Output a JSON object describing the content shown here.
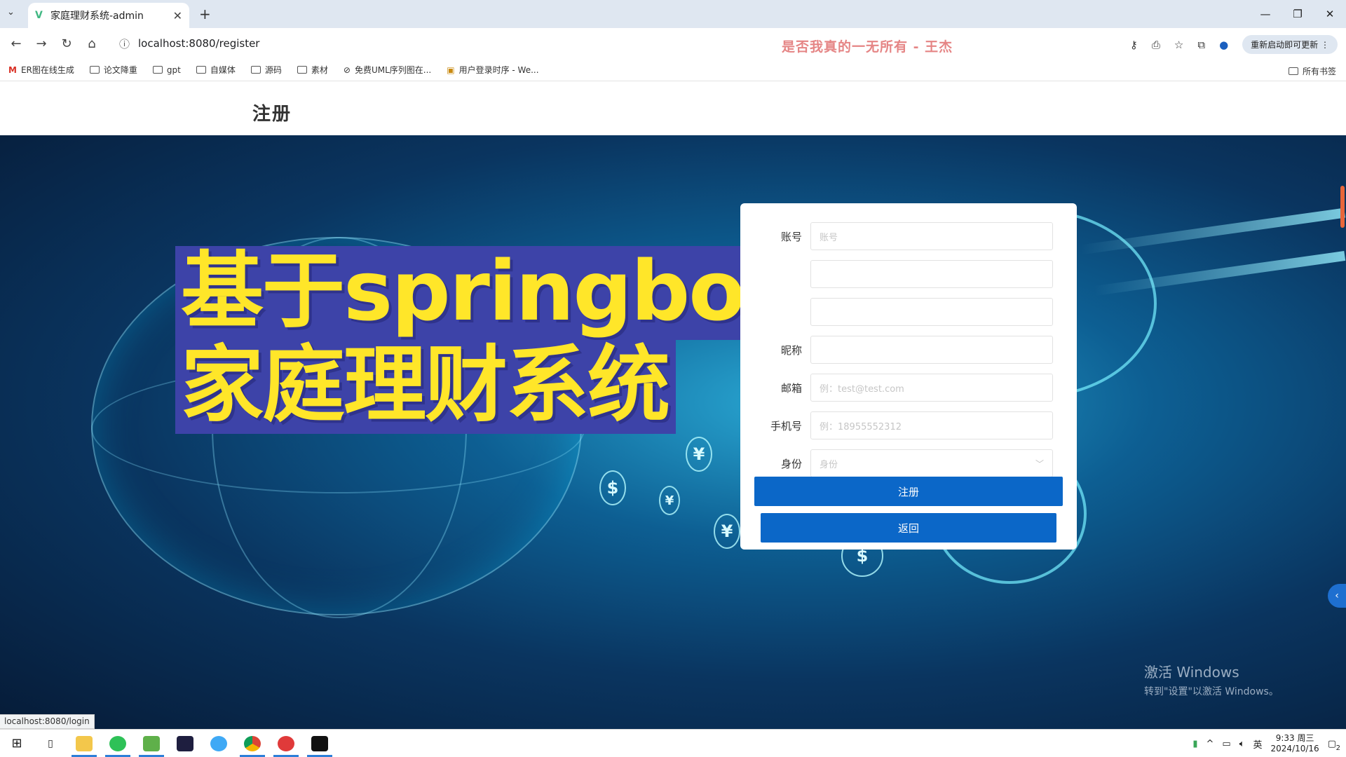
{
  "browser": {
    "tab_title": "家庭理财系统-admin",
    "tab_close": "✕",
    "tab_dropdown": "⌄",
    "new_tab": "+",
    "address": "localhost:8080/register",
    "lyric": "是否我真的一无所有 - 王杰",
    "update_button": "重新启动即可更新",
    "win_controls": {
      "minimize": "—",
      "restore": "❐",
      "close": "✕"
    },
    "nav": {
      "back": "←",
      "forward": "→",
      "reload": "↻",
      "home": "⌂"
    },
    "bookmarks": [
      {
        "label": "ER图在线生成",
        "icon": "m-logo-icon"
      },
      {
        "label": "论文降重",
        "icon": "folder-icon"
      },
      {
        "label": "gpt",
        "icon": "folder-icon"
      },
      {
        "label": "自媒体",
        "icon": "folder-icon"
      },
      {
        "label": "源码",
        "icon": "folder-icon"
      },
      {
        "label": "素材",
        "icon": "folder-icon"
      },
      {
        "label": "免费UML序列图在...",
        "icon": "uml-icon"
      },
      {
        "label": "用户登录时序 - We...",
        "icon": "page-icon"
      }
    ],
    "all_bookmarks": "所有书签",
    "status_url": "localhost:8080/login"
  },
  "page": {
    "title": "注册",
    "overlay_title_line1": "基于springboot的",
    "overlay_title_line2": "家庭理财系统"
  },
  "form": {
    "fields": [
      {
        "label": "账号",
        "placeholder": "账号"
      },
      {
        "label": "",
        "placeholder": ""
      },
      {
        "label": "",
        "placeholder": ""
      },
      {
        "label": "昵称",
        "placeholder": ""
      },
      {
        "label": "邮箱",
        "placeholder": "例：test@test.com"
      },
      {
        "label": "手机号",
        "placeholder": "例：18955552312"
      },
      {
        "label": "身份",
        "placeholder": "身份"
      }
    ],
    "register_button": "注册",
    "back_button": "返回"
  },
  "watermark": {
    "line1": "激活 Windows",
    "line2": "转到\"设置\"以激活 Windows。"
  },
  "taskbar": {
    "ime": "英",
    "time": "9:33 周三",
    "date": "2024/10/16",
    "notification_count": "2"
  },
  "colors": {
    "primary_button": "#0b67c8",
    "overlay_yellow": "#ffe629",
    "overlay_bg": "#3d43a8"
  }
}
